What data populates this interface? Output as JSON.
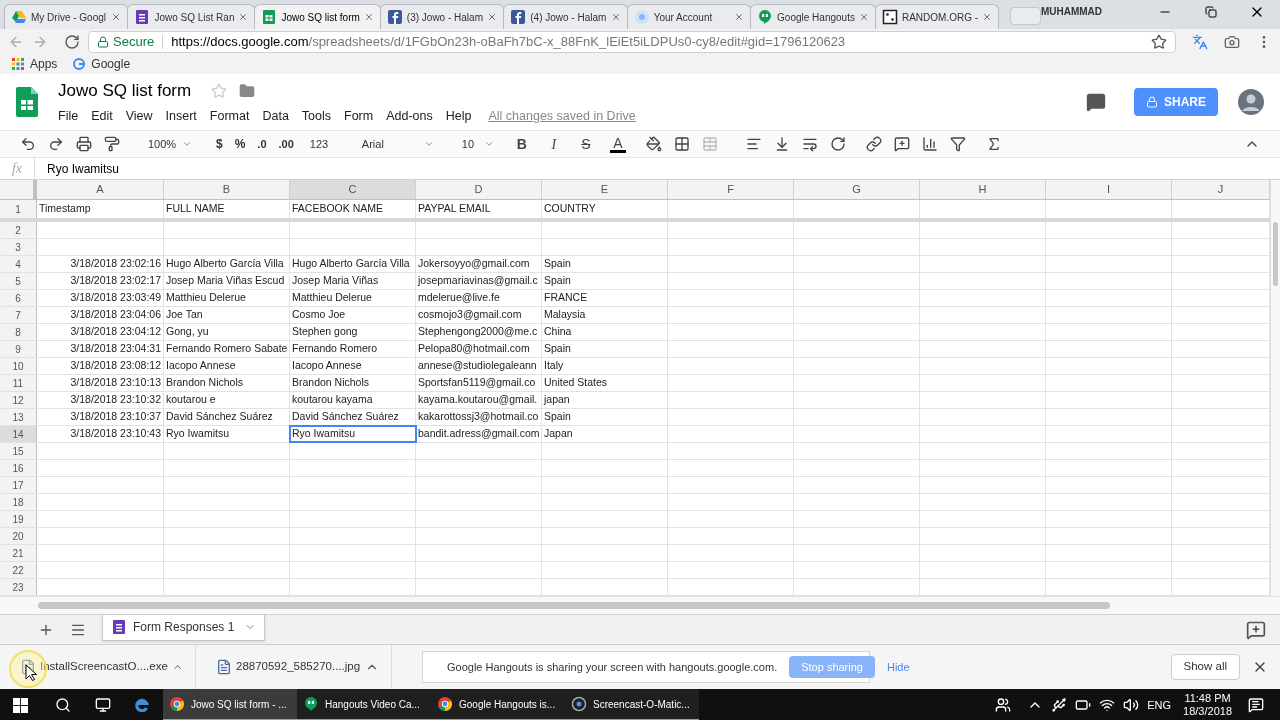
{
  "browser": {
    "tabs": [
      {
        "title": "My Drive - Googl",
        "kind": "drive",
        "selected": false
      },
      {
        "title": "Jowo SQ List Ran",
        "kind": "forms",
        "selected": false
      },
      {
        "title": "Jowo SQ list form",
        "kind": "sheets",
        "selected": true
      },
      {
        "title": "(3) Jowo - Halam",
        "kind": "facebook",
        "selected": false
      },
      {
        "title": "(4) Jowo - Halam",
        "kind": "facebook",
        "selected": false
      },
      {
        "title": "Your Account",
        "kind": "account",
        "selected": false
      },
      {
        "title": "Google Hangouts",
        "kind": "hangouts",
        "selected": false
      },
      {
        "title": "RANDOM.ORG -",
        "kind": "random",
        "selected": false
      }
    ],
    "profile": "MUHAMMAD",
    "secure": "Secure",
    "url_host": "https://docs.google.com",
    "url_path": "/spreadsheets/d/1FGbOn23h-oBaFh7bC-x_88FnK_lEiEt5iLDPUs0-cy8/edit#gid=1796120623",
    "bookmarks": [
      "Apps",
      "Google"
    ]
  },
  "sheets": {
    "title": "Jowo SQ list form",
    "menu": [
      "File",
      "Edit",
      "View",
      "Insert",
      "Format",
      "Data",
      "Tools",
      "Form",
      "Add-ons",
      "Help"
    ],
    "save_status": "All changes saved in Drive",
    "share": "SHARE",
    "toolbar": {
      "zoom": "100%",
      "currency": "$",
      "percent": "%",
      "decimal_decrease": ".0",
      "decimal_increase": ".00",
      "number_format": "123",
      "font": "Arial",
      "font_size": "10",
      "format_buttons": [
        {
          "label": "B",
          "kind": "bold"
        },
        {
          "label": "I",
          "kind": "italic"
        },
        {
          "label": "S",
          "kind": "strike"
        },
        {
          "label": "A",
          "kind": "color"
        }
      ]
    },
    "formula_bar": {
      "label": "fx",
      "value": "Ryo Iwamitsu"
    }
  },
  "grid": {
    "columns": [
      {
        "label": "A",
        "selected": false
      },
      {
        "label": "B",
        "selected": false
      },
      {
        "label": "C",
        "selected": true
      },
      {
        "label": "D",
        "selected": false
      },
      {
        "label": "E",
        "selected": false
      },
      {
        "label": "F",
        "selected": false
      },
      {
        "label": "G",
        "selected": false
      },
      {
        "label": "H",
        "selected": false
      },
      {
        "label": "I",
        "selected": false
      },
      {
        "label": "J",
        "selected": false
      }
    ],
    "rows": [
      {
        "number": "1",
        "selected": false,
        "cells": [
          "Timestamp",
          "FULL NAME",
          "FACEBOOK NAME",
          "PAYPAL EMAIL",
          "COUNTRY"
        ]
      },
      {
        "number": "2",
        "selected": false
      },
      {
        "number": "3",
        "selected": false
      },
      {
        "number": "4",
        "selected": false,
        "cells": [
          "3/18/2018 23:02:16",
          "Hugo Alberto García Villa",
          "Hugo Alberto García Villa",
          "Jokersoyyo@gmail.com",
          "Spain"
        ]
      },
      {
        "number": "5",
        "selected": false,
        "cells": [
          "3/18/2018 23:02:17",
          "Josep Maria Viñas Escud",
          "Josep Maria Viñas",
          "josepmariavinas@gmail.c",
          "Spain"
        ]
      },
      {
        "number": "6",
        "selected": false,
        "cells": [
          "3/18/2018 23:03:49",
          "Matthieu Delerue",
          "Matthieu Delerue",
          "mdelerue@live.fe",
          "FRANCE"
        ]
      },
      {
        "number": "7",
        "selected": false,
        "cells": [
          "3/18/2018 23:04:06",
          "Joe Tan",
          "Cosmo Joe",
          "cosmojo3@gmail.com",
          "Malaysia"
        ]
      },
      {
        "number": "8",
        "selected": false,
        "cells": [
          "3/18/2018 23:04:12",
          "Gong, yu",
          "Stephen gong",
          "Stephengong2000@me.c",
          "China"
        ]
      },
      {
        "number": "9",
        "selected": false,
        "cells": [
          "3/18/2018 23:04:31",
          "Fernando Romero Sabate",
          "Fernando Romero",
          "Pelopa80@hotmail.com",
          "Spain"
        ]
      },
      {
        "number": "10",
        "selected": false,
        "cells": [
          "3/18/2018 23:08:12",
          "Iacopo Annese",
          "Iacopo Annese",
          "annese@studiolegaleann",
          "Italy"
        ]
      },
      {
        "number": "11",
        "selected": false,
        "cells": [
          "3/18/2018 23:10:13",
          "Brandon Nichols",
          "Brandon Nichols",
          "Sportsfan5119@gmail.co",
          "United States"
        ]
      },
      {
        "number": "12",
        "selected": false,
        "cells": [
          "3/18/2018 23:10:32",
          "koutarou e",
          "koutarou kayama",
          "kayama.koutarou@gmail.",
          "japan"
        ]
      },
      {
        "number": "13",
        "selected": false,
        "cells": [
          "3/18/2018 23:10:37",
          "David Sánchez Suárez",
          "David Sánchez Suárez",
          "kakarottossj3@hotmail.co",
          "Spain"
        ]
      },
      {
        "number": "14",
        "selected": true,
        "cells": [
          "3/18/2018 23:10:43",
          "Ryo Iwamitsu",
          "Ryo Iwamitsu",
          "bandit.adress@gmail.com",
          "Japan"
        ]
      },
      {
        "number": "15",
        "selected": false
      },
      {
        "number": "16",
        "selected": false
      },
      {
        "number": "17",
        "selected": false
      },
      {
        "number": "18",
        "selected": false
      },
      {
        "number": "19",
        "selected": false
      },
      {
        "number": "20",
        "selected": false
      },
      {
        "number": "21",
        "selected": false
      },
      {
        "number": "22",
        "selected": false
      },
      {
        "number": "23",
        "selected": false
      }
    ]
  },
  "sheet_tabs": [
    {
      "label": "Form Responses 1",
      "selected": true
    }
  ],
  "downloads": {
    "items": [
      "InstallScreencastO....exe",
      "28870592_585270....jpg"
    ],
    "show_all": "Show all"
  },
  "sharing_bar": {
    "message": "Google Hangouts is sharing your screen with hangouts.google.com.",
    "stop": "Stop sharing",
    "hide": "Hide"
  },
  "taskbar": {
    "apps": [
      {
        "label": "Jowo SQ list form - ...",
        "kind": "chrome",
        "selected": true
      },
      {
        "label": "Hangouts Video Ca...",
        "kind": "hangouts",
        "selected": false
      },
      {
        "label": "Google Hangouts is...",
        "kind": "chrome",
        "selected": false
      },
      {
        "label": "Screencast-O-Matic...",
        "kind": "screencast",
        "selected": false
      }
    ],
    "language": "ENG",
    "time": "11:48 PM",
    "date": "18/3/2018"
  }
}
